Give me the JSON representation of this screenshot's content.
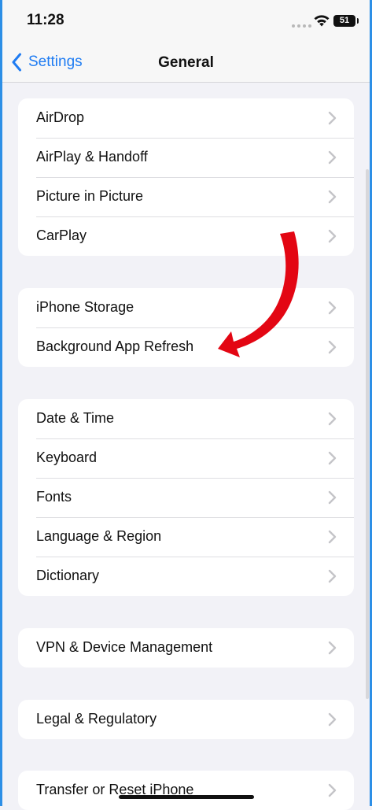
{
  "status_bar": {
    "time": "11:28",
    "battery": "51"
  },
  "nav": {
    "back_label": "Settings",
    "title": "General"
  },
  "groups": [
    {
      "items": [
        {
          "label": "AirDrop"
        },
        {
          "label": "AirPlay & Handoff"
        },
        {
          "label": "Picture in Picture"
        },
        {
          "label": "CarPlay"
        }
      ]
    },
    {
      "items": [
        {
          "label": "iPhone Storage"
        },
        {
          "label": "Background App Refresh"
        }
      ]
    },
    {
      "items": [
        {
          "label": "Date & Time"
        },
        {
          "label": "Keyboard"
        },
        {
          "label": "Fonts"
        },
        {
          "label": "Language & Region"
        },
        {
          "label": "Dictionary"
        }
      ]
    },
    {
      "items": [
        {
          "label": "VPN & Device Management"
        }
      ]
    },
    {
      "items": [
        {
          "label": "Legal & Regulatory"
        }
      ]
    },
    {
      "items": [
        {
          "label": "Transfer or Reset iPhone"
        }
      ]
    }
  ],
  "colors": {
    "accent": "#1f7cf2",
    "arrow": "#e30613",
    "frame": "#2d8fe6"
  },
  "icons": {
    "back": "chevron-left-icon",
    "row": "chevron-right-icon",
    "wifi": "wifi-icon",
    "arrow": "red-arrow-annotation"
  }
}
